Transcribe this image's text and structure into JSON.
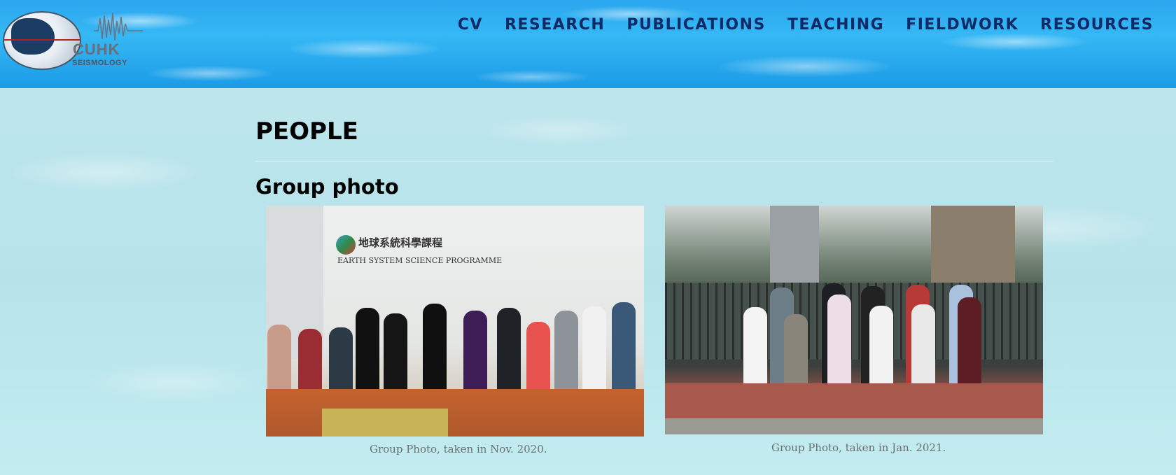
{
  "header": {
    "logo": {
      "text": "CUHK",
      "subtext": "SEISMOLOGY"
    },
    "nav": [
      "CV",
      "RESEARCH",
      "PUBLICATIONS",
      "TEACHING",
      "FIELDWORK",
      "RESOURCES"
    ]
  },
  "main": {
    "title": "PEOPLE",
    "section_title": "Group photo",
    "photos": [
      {
        "caption": "Group Photo, taken in Nov. 2020.",
        "sign_text": "地球系統科學課程",
        "sign_sub": "EARTH SYSTEM SCIENCE PROGRAMME"
      },
      {
        "caption": "Group Photo, taken in Jan. 2021."
      }
    ]
  },
  "colors": {
    "nav": "#0d2a66",
    "header_sky": "#2aa6ee",
    "body_bg": "#bfe9ee"
  }
}
